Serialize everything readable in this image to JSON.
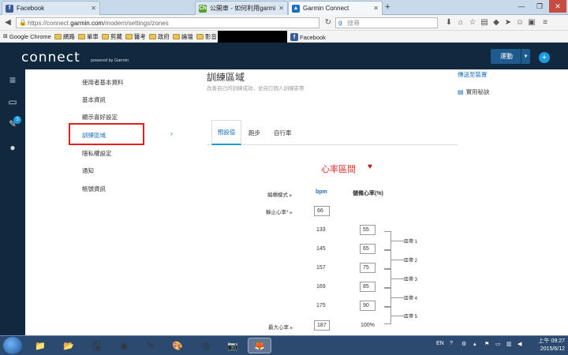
{
  "browser": {
    "tabs": [
      {
        "label": "Facebook",
        "active": false
      },
      {
        "label": "公開車 - 如何利用garmin...",
        "active": false
      },
      {
        "label": "Garmin Connect",
        "active": true
      }
    ],
    "url_prefix": "https://connect.",
    "url_domain": "garmin.com",
    "url_path": "/modern/settings/zones",
    "search_placeholder": "搜尋"
  },
  "bookmarks": [
    "Google Chrome",
    "網路",
    "單車",
    "剪藏",
    "醫考",
    "政府",
    "論壇",
    "影音",
    "Facebook"
  ],
  "app": {
    "logo": "connect",
    "powered": "powered by Garmin",
    "sport_button": "運動",
    "badge_count": "3"
  },
  "settings_nav": {
    "items": [
      "使用者基本資料",
      "基本資訊",
      "顯示喜好設定",
      "訓練區域",
      "隱私權設定",
      "通知",
      "帳號資訊"
    ],
    "selected": "訓練區域"
  },
  "page": {
    "title": "訓練區域",
    "subtitle": "改善自己的訓練成效，並自訂個人訓練區帶",
    "back_link": "傳送至裝置",
    "help_link": "實用秘訣",
    "tabs": [
      "預設值",
      "跑步",
      "自行車"
    ]
  },
  "heart_rate": {
    "title": "心率區間",
    "edit_mode_label": "編輯模式",
    "unit_label": "bpm",
    "reserve_label": "儲備心率(%)",
    "resting_label": "靜止心率*",
    "resting_value": "66",
    "max_label": "最大心率",
    "max_value": "187",
    "max_pct": "100%",
    "rows": [
      {
        "bpm": "133",
        "pct": "55"
      },
      {
        "bpm": "145",
        "pct": "65"
      },
      {
        "bpm": "157",
        "pct": "75"
      },
      {
        "bpm": "169",
        "pct": "85"
      },
      {
        "bpm": "175",
        "pct": "90"
      }
    ],
    "zones": [
      "區帶 1",
      "區帶 2",
      "區帶 3",
      "區帶 4",
      "區帶 5"
    ]
  },
  "taskbar": {
    "lang": "EN",
    "time": "上午 09:27",
    "date": "2015/6/12"
  },
  "colors": {
    "header": "#11293f",
    "accent": "#1a9be0",
    "highlight": "#e02020",
    "hr_title": "#e0302a"
  }
}
